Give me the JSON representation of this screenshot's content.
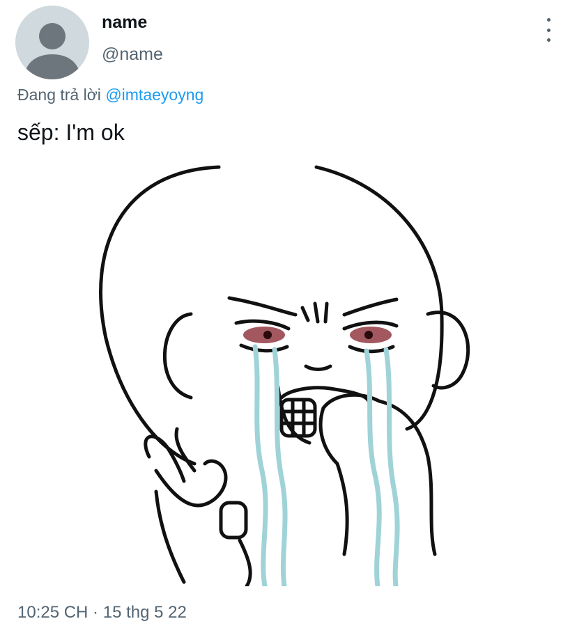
{
  "tweet": {
    "author": {
      "display_name": "name",
      "handle": "@name",
      "avatar_icon": "default-avatar-icon"
    },
    "more_icon": "more-vertical-icon",
    "reply_prefix": "Đang trả lời",
    "reply_mention": "@imtaeyoyng",
    "text": "sếp: I'm ok",
    "timestamp": "10:25 CH · 15 thg 5 22"
  },
  "colors": {
    "primary_text": "#0f1419",
    "secondary_text": "#536471",
    "link": "#1d9bf0",
    "avatar_bg": "#cfd9de",
    "avatar_fg": "#6e767d",
    "tears": "#9fd3d8",
    "eyes": "#8b2e36"
  }
}
